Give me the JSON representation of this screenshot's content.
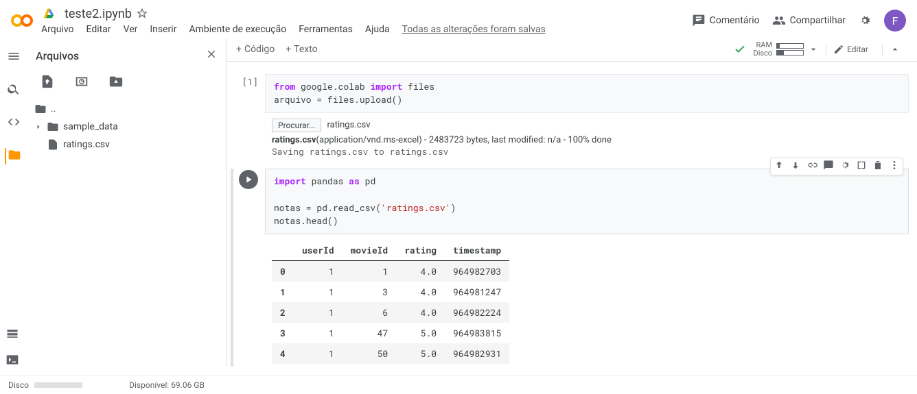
{
  "header": {
    "doc_title": "teste2.ipynb",
    "menus": [
      "Arquivo",
      "Editar",
      "Ver",
      "Inserir",
      "Ambiente de execução",
      "Ferramentas",
      "Ajuda"
    ],
    "saved_msg": "Todas as alterações foram salvas",
    "comment": "Comentário",
    "share": "Compartilhar",
    "avatar_letter": "F"
  },
  "files": {
    "title": "Arquivos",
    "items": {
      "up": "..",
      "folder": "sample_data",
      "file": "ratings.csv"
    }
  },
  "main_toolbar": {
    "code": "Código",
    "text": "Texto",
    "ram": "RAM",
    "disk": "Disco",
    "edit": "Editar"
  },
  "cell1": {
    "index": "[1]",
    "code_line1_from": "from",
    "code_line1_mod": " google.colab ",
    "code_line1_import": "import",
    "code_line1_rest": " files",
    "code_line2": "arquivo = files.upload()",
    "browse": "Procurar...",
    "browse_file": "ratings.csv",
    "output_bold": "ratings.csv",
    "output_rest": "(application/vnd.ms-excel) - 2483723 bytes, last modified: n/a - 100% done",
    "output_saving": "Saving ratings.csv to ratings.csv"
  },
  "cell2": {
    "line1_import": "import",
    "line1_mod": " pandas ",
    "line1_as": "as",
    "line1_alias": " pd",
    "line2_empty": "",
    "line3_pre": "notas = pd.read_csv(",
    "line3_str": "'ratings.csv'",
    "line3_post": ")",
    "line4": "notas.head()"
  },
  "table": {
    "columns": [
      "userId",
      "movieId",
      "rating",
      "timestamp"
    ],
    "rows": [
      {
        "idx": "0",
        "userId": "1",
        "movieId": "1",
        "rating": "4.0",
        "timestamp": "964982703"
      },
      {
        "idx": "1",
        "userId": "1",
        "movieId": "3",
        "rating": "4.0",
        "timestamp": "964981247"
      },
      {
        "idx": "2",
        "userId": "1",
        "movieId": "6",
        "rating": "4.0",
        "timestamp": "964982224"
      },
      {
        "idx": "3",
        "userId": "1",
        "movieId": "47",
        "rating": "5.0",
        "timestamp": "964983815"
      },
      {
        "idx": "4",
        "userId": "1",
        "movieId": "50",
        "rating": "5.0",
        "timestamp": "964982931"
      }
    ]
  },
  "bottom": {
    "disk_label": "Disco",
    "available": "Disponível: 69.06 GB"
  }
}
